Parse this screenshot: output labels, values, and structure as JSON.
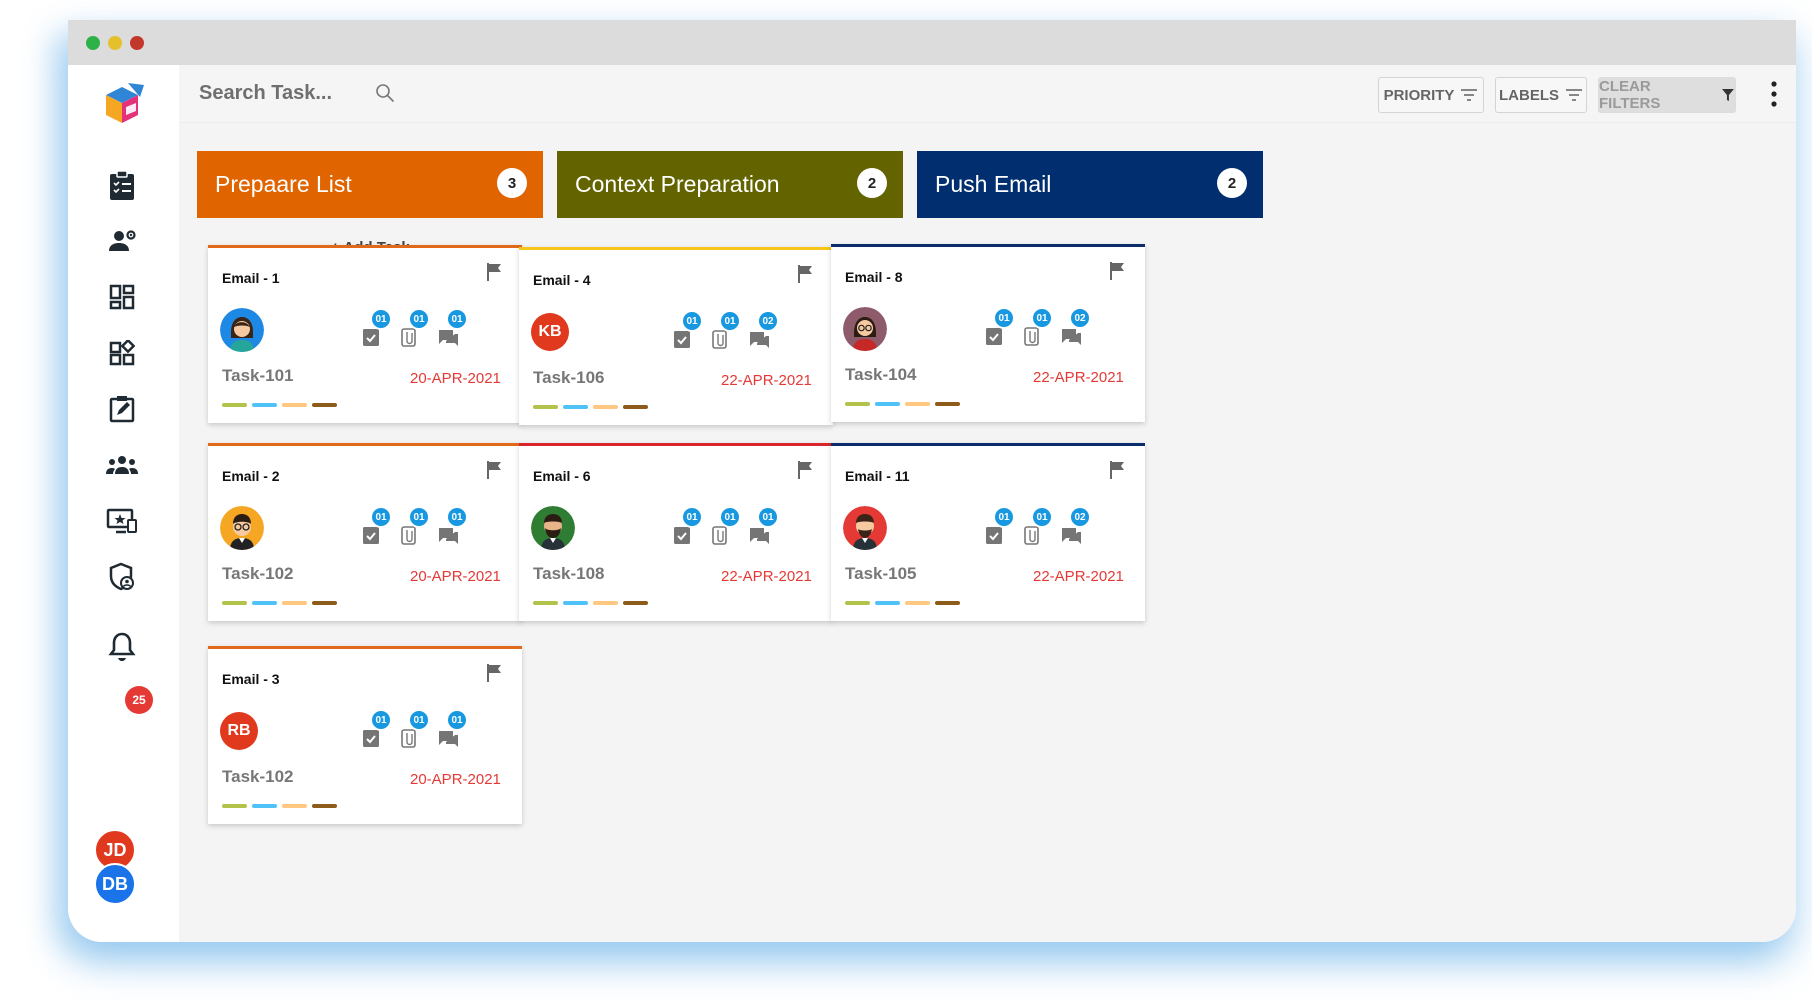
{
  "window": {
    "traffic_lights": [
      "#2db24a",
      "#e6c02c",
      "#c2392b"
    ]
  },
  "sidebar": {
    "items": [
      "clipboard-list-icon",
      "team-settings-icon",
      "dashboard-icon",
      "widgets-icon",
      "edit-task-icon",
      "group-icon",
      "monitor-star-icon",
      "shield-user-icon",
      "bell-icon"
    ],
    "notification_count": "25",
    "users": [
      {
        "initials": "JD",
        "color": "#e0391e"
      },
      {
        "initials": "DB",
        "color": "#1a73e8"
      }
    ]
  },
  "topbar": {
    "search_placeholder": "Search Task...",
    "priority_label": "PRIORITY",
    "labels_label": "LABELS",
    "clear_filters_label": "CLEAR FILTERS"
  },
  "label_colors": [
    "#b3c24a",
    "#4fc3f7",
    "#ffc77f",
    "#8d5b1a"
  ],
  "columns": [
    {
      "title": "Prepaare List",
      "count": "3",
      "color": "#e06400",
      "add_task_label": "+ Add Task",
      "cards": [
        {
          "title": "Email - 1",
          "avatar": "female",
          "task": "Task-101",
          "date": "20-APR-2021",
          "border": "#e06a1a",
          "stats": [
            "01",
            "01",
            "01"
          ]
        },
        {
          "title": "Email - 2",
          "avatar": "glasses",
          "task": "Task-102",
          "date": "20-APR-2021",
          "border": "#e06a1a",
          "stats": [
            "01",
            "01",
            "01"
          ]
        },
        {
          "title": "Email - 3",
          "avatar_initials": "RB",
          "avatar_color": "#e0391e",
          "task": "Task-102",
          "date": "20-APR-2021",
          "border": "#e06a1a",
          "stats": [
            "01",
            "01",
            "01"
          ]
        }
      ]
    },
    {
      "title": "Context Preparation",
      "count": "2",
      "color": "#636400",
      "cards": [
        {
          "title": "Email - 4",
          "avatar_initials": "KB",
          "avatar_color": "#e0391e",
          "task": "Task-106",
          "date": "22-APR-2021",
          "border": "#f5c518",
          "stats": [
            "01",
            "01",
            "02"
          ]
        },
        {
          "title": "Email - 6",
          "avatar": "beard",
          "task": "Task-108",
          "date": "22-APR-2021",
          "border": "#d9262c",
          "stats": [
            "01",
            "01",
            "01"
          ]
        }
      ]
    },
    {
      "title": "Push Email",
      "count": "2",
      "color": "#002e6e",
      "cards": [
        {
          "title": "Email - 8",
          "avatar": "woman-red",
          "task": "Task-104",
          "date": "22-APR-2021",
          "border": "#0b2d6b",
          "stats": [
            "01",
            "01",
            "02"
          ]
        },
        {
          "title": "Email - 11",
          "avatar": "man-red",
          "task": "Task-105",
          "date": "22-APR-2021",
          "border": "#0b2d6b",
          "stats": [
            "01",
            "01",
            "02"
          ]
        }
      ]
    }
  ]
}
